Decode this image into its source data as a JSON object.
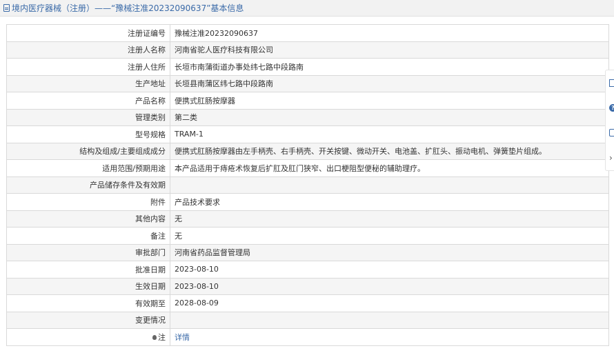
{
  "header": {
    "title": "境内医疗器械（注册）——“豫械注准20232090637”基本信息"
  },
  "detail_link": "详情",
  "rows": [
    {
      "label": "注册证编号",
      "value": "豫械注准20232090637"
    },
    {
      "label": "注册人名称",
      "value": "河南省驼人医疗科技有限公司"
    },
    {
      "label": "注册人住所",
      "value": "长垣市南蒲街道办事处纬七路中段路南"
    },
    {
      "label": "生产地址",
      "value": "长垣县南蒲区纬七路中段路南"
    },
    {
      "label": "产品名称",
      "value": "便携式肛肠按摩器"
    },
    {
      "label": "管理类别",
      "value": "第二类"
    },
    {
      "label": "型号规格",
      "value": "TRAM-1"
    },
    {
      "label": "结构及组成/主要组成成分",
      "value": "便携式肛肠按摩器由左手柄壳、右手柄壳、开关按键、微动开关、电池盖、扩肛头、振动电机、弹簧垫片组成。"
    },
    {
      "label": "适用范围/预期用途",
      "value": "本产品适用于痔疮术恢复后扩肛及肛门狭窄、出口梗阻型便秘的辅助理疗。"
    },
    {
      "label": "产品储存条件及有效期",
      "value": ""
    },
    {
      "label": "附件",
      "value": "产品技术要求"
    },
    {
      "label": "其他内容",
      "value": "无"
    },
    {
      "label": "备注",
      "value": "无"
    },
    {
      "label": "审批部门",
      "value": "河南省药品监督管理局"
    },
    {
      "label": "批准日期",
      "value": "2023-08-10"
    },
    {
      "label": "生效日期",
      "value": "2023-08-10"
    },
    {
      "label": "有效期至",
      "value": "2028-08-09"
    },
    {
      "label": "变更情况",
      "value": ""
    },
    {
      "label": "注",
      "value": ""
    }
  ],
  "side_toolbar": {
    "help_glyph": "?",
    "arrow_glyph": "›"
  },
  "colors": {
    "link": "#3a6aa8",
    "border": "#d9d9d9",
    "shaded_row": "#f5f5f5",
    "header_bg": "#f2f2f2"
  }
}
